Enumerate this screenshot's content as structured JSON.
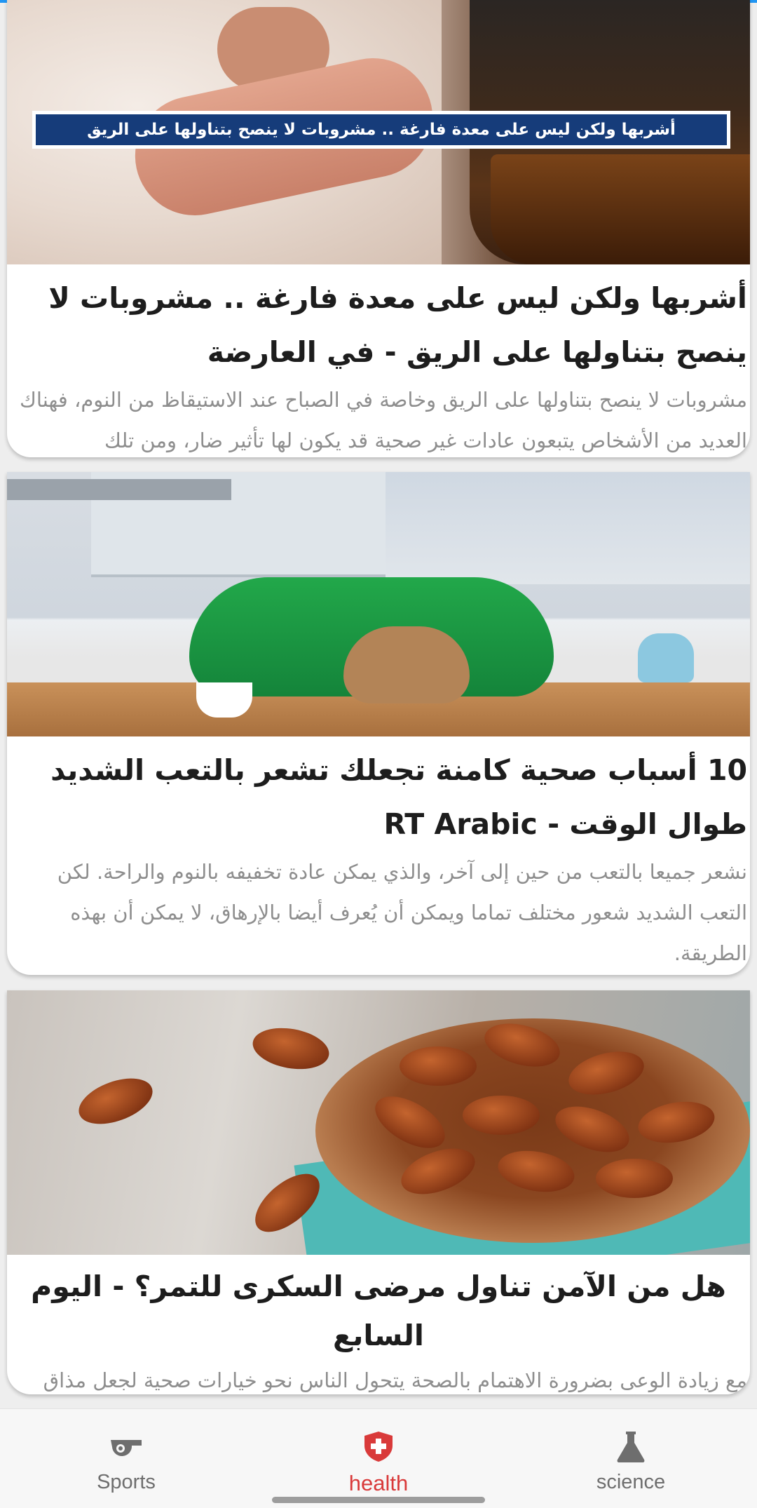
{
  "articles": [
    {
      "image_caption": "أشربها ولكن ليس على معدة فارغة .. مشروبات لا ينصح بتناولها على الريق",
      "title": "أشربها ولكن ليس على معدة فارغة .. مشروبات لا ينصح بتناولها على الريق - في العارضة",
      "description": "مشروبات لا ينصح بتناولها على الريق وخاصة في الصباح عند الاستيقاظ من النوم، فهناك العديد من الأشخاص يتبعون عادات غير صحية قد يكون لها تأثير ضار، ومن تلك"
    },
    {
      "title": "10 أسباب صحية كامنة تجعلك تشعر بالتعب الشديد طوال الوقت - RT Arabic",
      "description": "نشعر جميعا بالتعب من حين إلى آخر، والذي يمكن عادة تخفيفه بالنوم والراحة. لكن التعب الشديد شعور مختلف تماما ويمكن أن يُعرف أيضا بالإرهاق، لا يمكن أن بهذه الطريقة."
    },
    {
      "title": "هل من الآمن تناول مرضى السكرى للتمر؟ - اليوم السابع",
      "description": "مع زيادة الوعى بضرورة الاهتمام بالصحة يتحول الناس نحو خيارات صحية لجعل مذاق الطعام أفضل وذو قيمة وفائدة عالية."
    }
  ],
  "bottom_nav": {
    "items": [
      {
        "label": "Sports",
        "icon": "whistle-icon",
        "active": false
      },
      {
        "label": "health",
        "icon": "health-shield-icon",
        "active": true
      },
      {
        "label": "science",
        "icon": "flask-icon",
        "active": false
      }
    ],
    "active_color": "#d93a3a",
    "inactive_color": "#6e6e6e"
  }
}
